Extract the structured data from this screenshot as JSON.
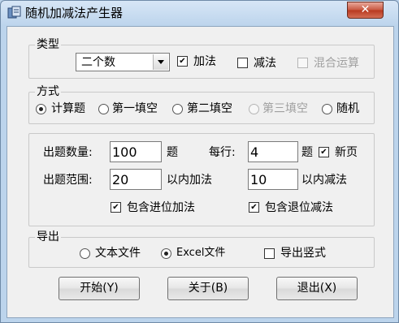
{
  "window": {
    "title": "随机加减法产生器",
    "close": "✕"
  },
  "type_group": {
    "label": "类型",
    "select_value": "二个数",
    "add_label": "加法",
    "add_checked": true,
    "sub_label": "减法",
    "sub_checked": false,
    "mixed_label": "混合运算",
    "mixed_checked": false
  },
  "mode_group": {
    "label": "方式",
    "options": [
      {
        "label": "计算题",
        "selected": true,
        "disabled": false
      },
      {
        "label": "第一填空",
        "selected": false,
        "disabled": false
      },
      {
        "label": "第二填空",
        "selected": false,
        "disabled": false
      },
      {
        "label": "第三填空",
        "selected": false,
        "disabled": true
      },
      {
        "label": "随机",
        "selected": false,
        "disabled": false
      }
    ]
  },
  "settings": {
    "count_label": "出题数量:",
    "count_value": "100",
    "count_unit": "题",
    "per_row_label": "每行:",
    "per_row_value": "4",
    "per_row_unit": "题",
    "new_page_label": "新页",
    "new_page_checked": true,
    "range_label": "出题范围:",
    "add_range_value": "20",
    "add_range_unit": "以内加法",
    "sub_range_value": "10",
    "sub_range_unit": "以内减法",
    "carry_label": "包含进位加法",
    "carry_checked": true,
    "borrow_label": "包含退位减法",
    "borrow_checked": true
  },
  "export_group": {
    "label": "导出",
    "text_file_label": "文本文件",
    "text_file_selected": false,
    "excel_file_label": "Excel文件",
    "excel_file_selected": true,
    "vertical_label": "导出竖式",
    "vertical_checked": false
  },
  "buttons": {
    "start": "开始(Y)",
    "about": "关于(B)",
    "exit": "退出(X)"
  },
  "check_mark": "✔"
}
